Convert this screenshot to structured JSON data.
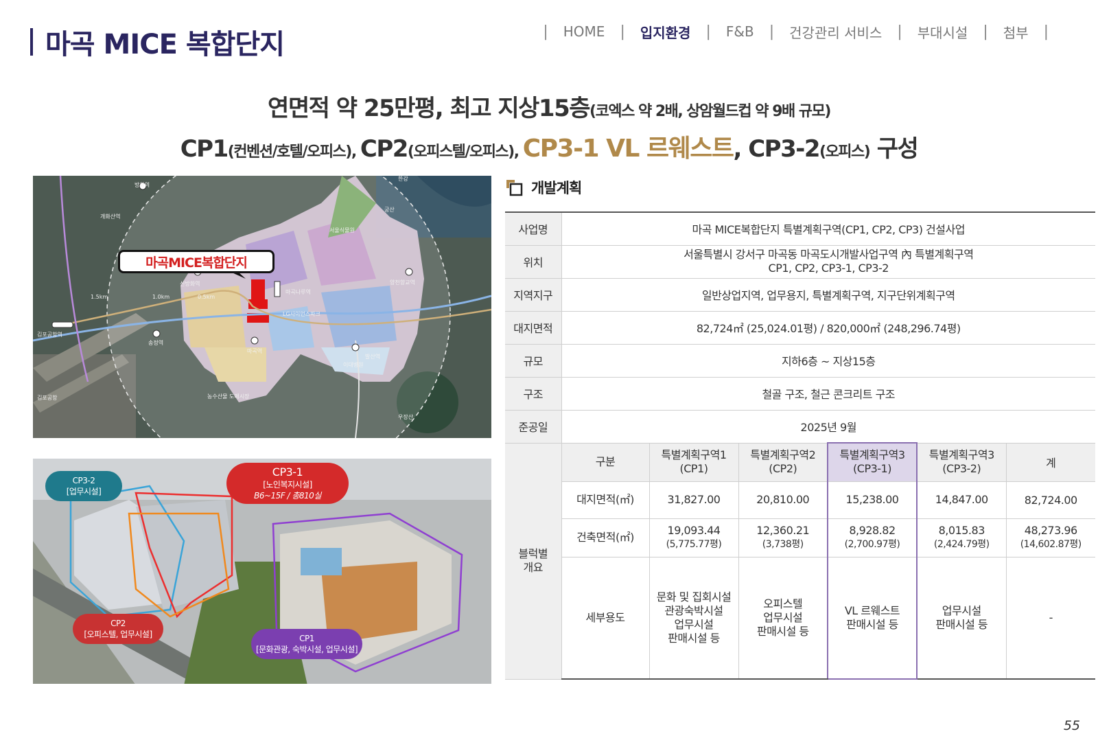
{
  "page": {
    "title": "마곡 MICE 복합단지",
    "number": "55"
  },
  "nav": {
    "items": [
      "HOME",
      "입지환경",
      "F&B",
      "건강관리 서비스",
      "부대시설",
      "첨부"
    ],
    "active": "입지환경"
  },
  "headline": {
    "line1_main": "연면적 약 25만평, 최고 지상15층",
    "line1_note": "(코엑스 약 2배, 상암월드컵 약 9배 규모)",
    "line2_cp1": "CP1",
    "line2_cp1_note": "(컨벤션/호텔/오피스), ",
    "line2_cp2": "CP2",
    "line2_cp2_note": "(오피스텔/오피스), ",
    "line2_highlight": "CP3-1 VL 르웨스트",
    "line2_cp32": ", CP3-2",
    "line2_cp32_note": "(오피스)",
    "line2_end": " 구성",
    "highlight_color": "#b0894a"
  },
  "map": {
    "callout": "마곡MICE복합단지",
    "labels": [
      "방화역",
      "서울식물원",
      "신방화역",
      "마곡나루역",
      "LG사이언스파크",
      "양천향교역",
      "송정역",
      "마곡역",
      "발산역",
      "이대병원",
      "김포공항역",
      "김포공항",
      "농수산물 도매시장",
      "우장산",
      "한강",
      "궁산",
      "개화산역",
      "1.5km",
      "1.0km",
      "0.5km"
    ]
  },
  "render": {
    "cp32": {
      "title": "CP3-2",
      "desc": "[업무시설]",
      "color": "#1f7a8c"
    },
    "cp31": {
      "title": "CP3-1",
      "desc": "[노인복지시설]",
      "extra": "B6~15F / 총810실",
      "color": "#d42a2a"
    },
    "cp2": {
      "title": "CP2",
      "desc": "[오피스텔, 업무시설]",
      "color": "#c83232"
    },
    "cp1": {
      "title": "CP1",
      "desc": "[문화관광, 숙박시설, 업무시설]",
      "color": "#7b3fb0"
    }
  },
  "section": {
    "title": "개발계획",
    "accent": "#b0894a"
  },
  "table": {
    "rows": [
      {
        "label": "사업명",
        "value": "마곡 MICE복합단지 특별계획구역(CP1, CP2, CP3) 건설사업"
      },
      {
        "label": "위치",
        "value": "서울특별시 강서구 마곡동 마곡도시개발사업구역 內 특별계획구역",
        "value2": "CP1, CP2, CP3-1, CP3-2"
      },
      {
        "label": "지역지구",
        "value": "일반상업지역, 업무용지, 특별계획구역, 지구단위계획구역"
      },
      {
        "label": "대지면적",
        "value": "82,724㎡ (25,024.01평) / 820,000㎡ (248,296.74평)"
      },
      {
        "label": "규모",
        "value": "지하6층 ~ 지상15층"
      },
      {
        "label": "구조",
        "value": "철골 구조, 철근 콘크리트 구조"
      },
      {
        "label": "준공일",
        "value": "2025년 9월"
      }
    ],
    "block": {
      "label_line1": "블럭별",
      "label_line2": "개요",
      "header": {
        "col0": "구분",
        "cols": [
          {
            "l1": "특별계획구역1",
            "l2": "(CP1)"
          },
          {
            "l1": "특별계획구역2",
            "l2": "(CP2)"
          },
          {
            "l1": "특별계획구역3",
            "l2": "(CP3-1)"
          },
          {
            "l1": "특별계획구역3",
            "l2": "(CP3-2)"
          },
          {
            "l1": "계",
            "l2": ""
          }
        ]
      },
      "site_area": {
        "label": "대지면적(㎡)",
        "values": [
          "31,827.00",
          "20,810.00",
          "15,238.00",
          "14,847.00",
          "82,724.00"
        ]
      },
      "building_area": {
        "label": "건축면적(㎡)",
        "values": [
          {
            "m2": "19,093.44",
            "py": "(5,775.77평)"
          },
          {
            "m2": "12,360.21",
            "py": "(3,738평)"
          },
          {
            "m2": "8,928.82",
            "py": "(2,700.97평)"
          },
          {
            "m2": "8,015.83",
            "py": "(2,424.79평)"
          },
          {
            "m2": "48,273.96",
            "py": "(14,602.87평)"
          }
        ]
      },
      "usage": {
        "label": "세부용도",
        "values": [
          [
            "문화 및 집회시설",
            "관광숙박시설",
            "업무시설",
            "판매시설 등"
          ],
          [
            "오피스텔",
            "업무시설",
            "판매시설 등"
          ],
          [
            "VL 르웨스트",
            "판매시설 등"
          ],
          [
            "업무시설",
            "판매시설 등"
          ],
          [
            "-"
          ]
        ]
      },
      "highlight_color": "#8a6fb0"
    }
  }
}
